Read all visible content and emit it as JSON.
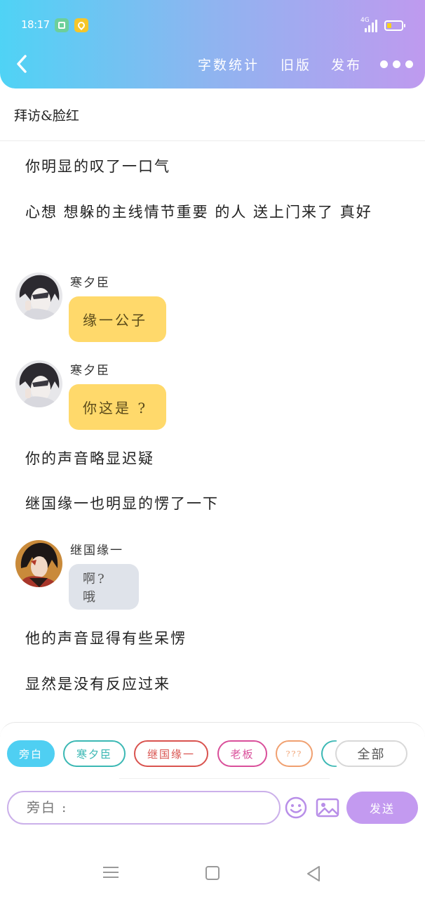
{
  "status_bar": {
    "time": "18:17",
    "network": "4G"
  },
  "header": {
    "actions": [
      "字数统计",
      "旧版",
      "发布"
    ]
  },
  "chapter": {
    "title": "拜访&脸红"
  },
  "story": {
    "narration_1": "你明显的叹了一口气",
    "narration_2": "心想 想躲的主线情节重要 的人 送上门来了 真好",
    "msg_1": {
      "name": "寒夕臣",
      "text": "缘一公子"
    },
    "msg_2": {
      "name": "寒夕臣",
      "text": "你这是 ?"
    },
    "narration_3": "你的声音略显迟疑",
    "narration_4": "继国缘一也明显的愣了一下",
    "msg_3": {
      "name": "继国缘一",
      "text": "啊? 哦"
    },
    "narration_5": "他的声音显得有些呆愣",
    "narration_6": "显然是没有反应过来"
  },
  "roles": [
    {
      "label": "旁白",
      "color": "#4fcff2",
      "selected": true
    },
    {
      "label": "寒夕臣",
      "color": "#3bb8b4"
    },
    {
      "label": "继国缘一",
      "color": "#d9534f"
    },
    {
      "label": "老板",
      "color": "#d94f9a"
    },
    {
      "label": "???",
      "color": "#f0a070"
    },
    {
      "label": "",
      "color": "#3bb8b4"
    }
  ],
  "all_label": "全部",
  "composer": {
    "placeholder": "旁白 :",
    "send_label": "发送"
  }
}
